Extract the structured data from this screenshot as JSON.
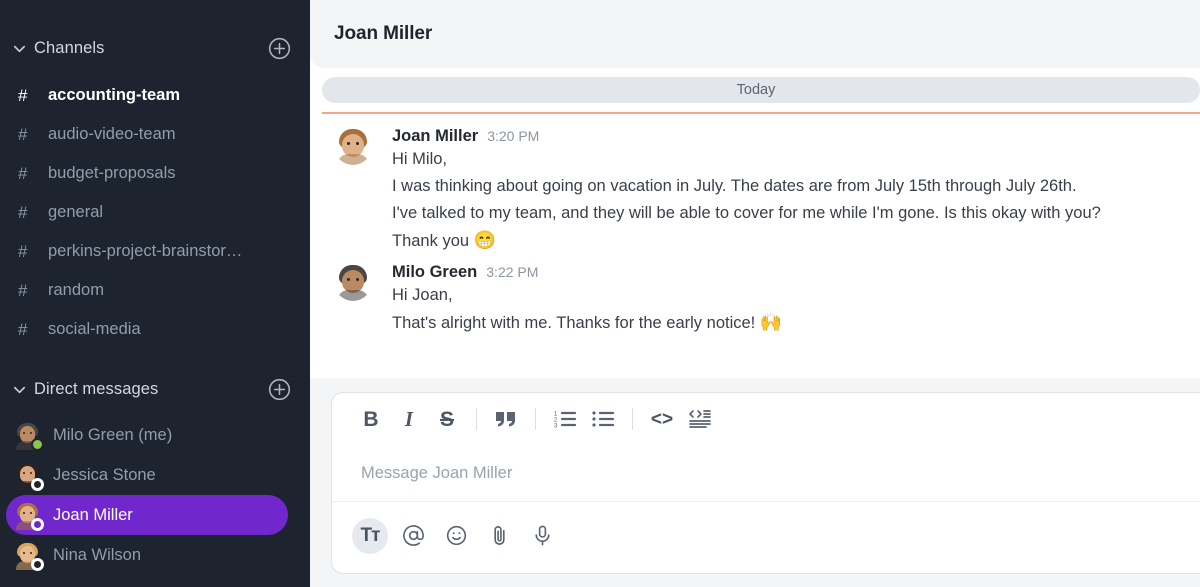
{
  "sidebar": {
    "channels_section": {
      "title": "Channels",
      "chevron_icon": "chevron-down-icon",
      "add_icon": "plus-circle-icon",
      "items": [
        {
          "name": "accounting-team",
          "active": true
        },
        {
          "name": "audio-video-team",
          "active": false
        },
        {
          "name": "budget-proposals",
          "active": false
        },
        {
          "name": "general",
          "active": false
        },
        {
          "name": "perkins-project-brainstor…",
          "active": false
        },
        {
          "name": "random",
          "active": false
        },
        {
          "name": "social-media",
          "active": false
        }
      ]
    },
    "dm_section": {
      "title": "Direct messages",
      "chevron_icon": "chevron-down-icon",
      "add_icon": "plus-circle-icon",
      "items": [
        {
          "name": "Milo Green (me)",
          "presence": "online",
          "selected": false
        },
        {
          "name": "Jessica Stone",
          "presence": "offline",
          "selected": false
        },
        {
          "name": "Joan Miller",
          "presence": "offline",
          "selected": true
        },
        {
          "name": "Nina Wilson",
          "presence": "offline",
          "selected": false
        }
      ]
    }
  },
  "header": {
    "title": "Joan Miller"
  },
  "conversation": {
    "day_divider": "Today",
    "messages": [
      {
        "author": "Joan Miller",
        "time": "3:20 PM",
        "lines": [
          {
            "text": "Hi Milo,",
            "emoji": ""
          },
          {
            "text": "I was thinking about going on vacation in July. The dates are from July 15th through July 26th.",
            "emoji": ""
          },
          {
            "text": "I've talked to my team, and they will be able to cover for me while I'm gone. Is this okay with you?",
            "emoji": ""
          },
          {
            "text": "Thank you ",
            "emoji": "😁"
          }
        ]
      },
      {
        "author": "Milo Green",
        "time": "3:22 PM",
        "lines": [
          {
            "text": "Hi Joan,",
            "emoji": ""
          },
          {
            "text": "That's alright with me. Thanks for the early notice! ",
            "emoji": "🙌"
          }
        ]
      }
    ]
  },
  "composer": {
    "placeholder": "Message Joan Miller",
    "format_tools": [
      {
        "id": "bold",
        "icon": "bold-icon",
        "label": "B"
      },
      {
        "id": "italic",
        "icon": "italic-icon",
        "label": "I"
      },
      {
        "id": "strikethrough",
        "icon": "strikethrough-icon",
        "label": "S"
      },
      {
        "id": "quote",
        "icon": "blockquote-icon",
        "label": "””"
      },
      {
        "id": "ordered-list",
        "icon": "ordered-list-icon",
        "label": ""
      },
      {
        "id": "bulleted-list",
        "icon": "bulleted-list-icon",
        "label": ""
      },
      {
        "id": "inline-code",
        "icon": "code-icon",
        "label": "<>"
      },
      {
        "id": "code-block",
        "icon": "code-block-icon",
        "label": ""
      }
    ],
    "action_tools": [
      {
        "id": "formatting",
        "icon": "text-format-icon",
        "label": "Tᴛ",
        "active": true
      },
      {
        "id": "mention",
        "icon": "at-mention-icon",
        "label": "@",
        "active": false
      },
      {
        "id": "emoji",
        "icon": "emoji-smiley-icon",
        "label": "",
        "active": false
      },
      {
        "id": "attach",
        "icon": "paperclip-icon",
        "label": "",
        "active": false
      },
      {
        "id": "voice",
        "icon": "microphone-icon",
        "label": "",
        "active": false
      }
    ]
  },
  "colors": {
    "sidebar_bg": "#1d2430",
    "selected_dm": "#7028cc",
    "header_bg": "#f3f5f7",
    "day_pill_bg": "#e3e7ec",
    "divider_orange": "#f4a58a",
    "presence_online": "#8ac54b"
  }
}
